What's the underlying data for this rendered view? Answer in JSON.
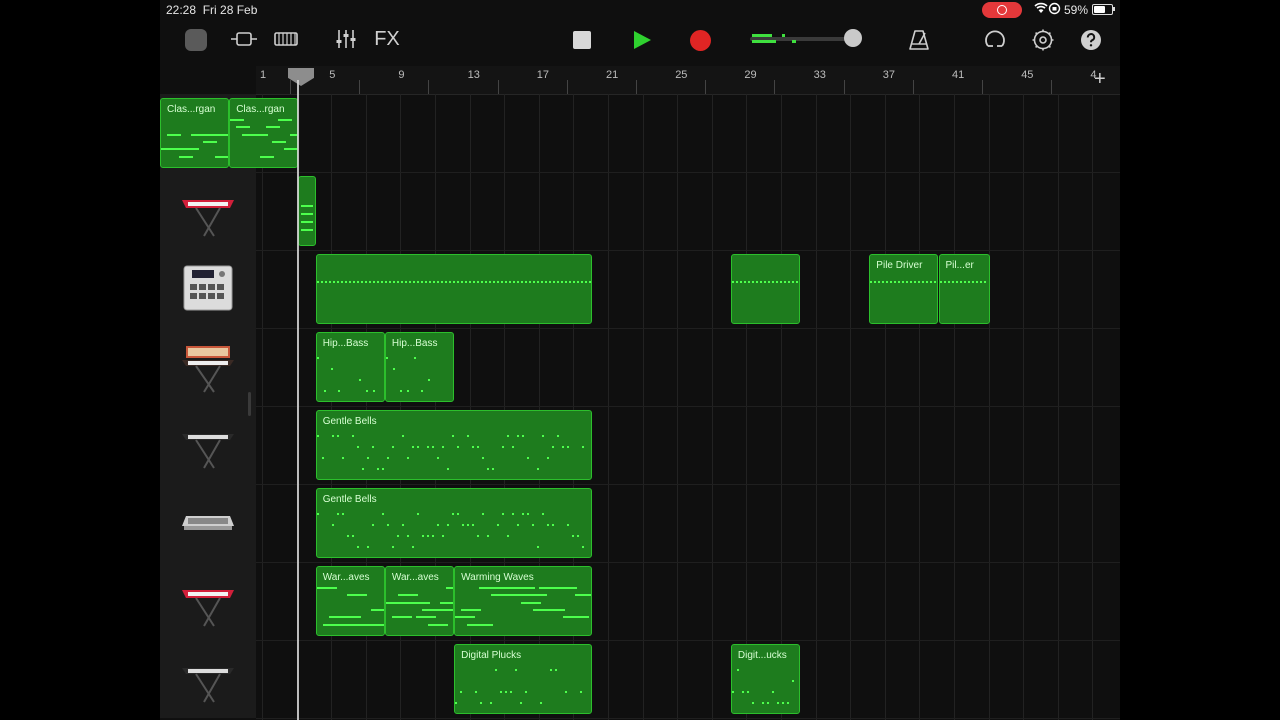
{
  "status": {
    "time": "22:28",
    "date": "Fri 28 Feb",
    "battery": "59%"
  },
  "toolbar": {
    "fx_label": "FX",
    "icons": [
      "my-songs-icon",
      "tracks-view-icon",
      "browser-icon",
      "mixer-icon",
      "stop-icon",
      "play-icon",
      "record-icon",
      "metronome-icon",
      "loop-icon",
      "settings-icon",
      "help-icon"
    ]
  },
  "ruler": {
    "bars": [
      "1",
      "5",
      "9",
      "13",
      "17",
      "21",
      "25",
      "29",
      "33",
      "37",
      "41",
      "45",
      "4"
    ]
  },
  "tracks": [
    {
      "instrument": "organ",
      "regions": [
        {
          "name": "Clas...rgan"
        },
        {
          "name": "Clas...rgan"
        }
      ]
    },
    {
      "instrument": "red-synth",
      "regions": [
        {
          "name": ""
        }
      ]
    },
    {
      "instrument": "drum-machine",
      "regions": [
        {
          "name": ""
        },
        {
          "name": ""
        },
        {
          "name": "Pile Driver"
        },
        {
          "name": "Pil...er"
        }
      ]
    },
    {
      "instrument": "analog-synth",
      "regions": [
        {
          "name": "Hip...Bass"
        },
        {
          "name": "Hip...Bass"
        }
      ]
    },
    {
      "instrument": "keyboard-stand",
      "regions": [
        {
          "name": "Gentle Bells"
        }
      ]
    },
    {
      "instrument": "synth-module",
      "regions": [
        {
          "name": "Gentle Bells"
        }
      ]
    },
    {
      "instrument": "red-synth",
      "regions": [
        {
          "name": "War...aves"
        },
        {
          "name": "War...aves"
        },
        {
          "name": "Warming Waves"
        }
      ]
    },
    {
      "instrument": "keyboard-stand",
      "regions": [
        {
          "name": "Digital Plucks"
        },
        {
          "name": "Digit...ucks"
        }
      ]
    }
  ],
  "colors": {
    "region_fill": "#1e7c1e",
    "region_border": "#2cbf2c",
    "note": "#4dff4d",
    "record": "#e02524",
    "play": "#2fd12f"
  }
}
